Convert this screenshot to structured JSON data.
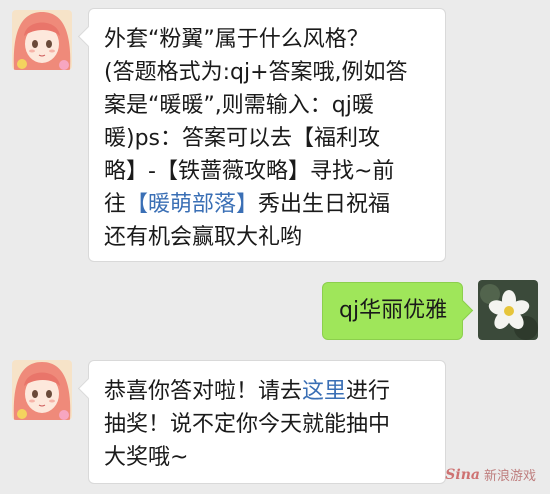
{
  "messages": [
    {
      "sender": "bot",
      "avatar": "anime-girl-avatar",
      "segments": [
        [
          "外套“粉翼”属于什么风格？"
        ],
        [
          "(答题格式为:qj+答案哦,例如答"
        ],
        [
          "案是“暖暖”,则需输入：qj暖"
        ],
        [
          "暖)ps：答案可以去【福利攻"
        ],
        [
          "略】-【铁蔷薇攻略】寻找~前"
        ],
        [
          "往",
          {
            "link": "【暖萌部落】"
          },
          "秀出生日祝福"
        ],
        [
          "还有机会赢取大礼哟"
        ]
      ]
    },
    {
      "sender": "user",
      "avatar": "white-flower-avatar",
      "text": "qj华丽优雅"
    },
    {
      "sender": "bot",
      "avatar": "anime-girl-avatar",
      "segments": [
        [
          "恭喜你答对啦！请去",
          {
            "link": "这里"
          },
          "进行"
        ],
        [
          "抽奖！说不定你今天就能抽中"
        ],
        [
          "大奖哦~"
        ]
      ]
    }
  ],
  "watermark": {
    "logo": "Sina",
    "text": "新浪游戏"
  },
  "colors": {
    "link": "#3a6fb5",
    "user_bubble": "#9fe65a",
    "background": "#ebebeb"
  }
}
